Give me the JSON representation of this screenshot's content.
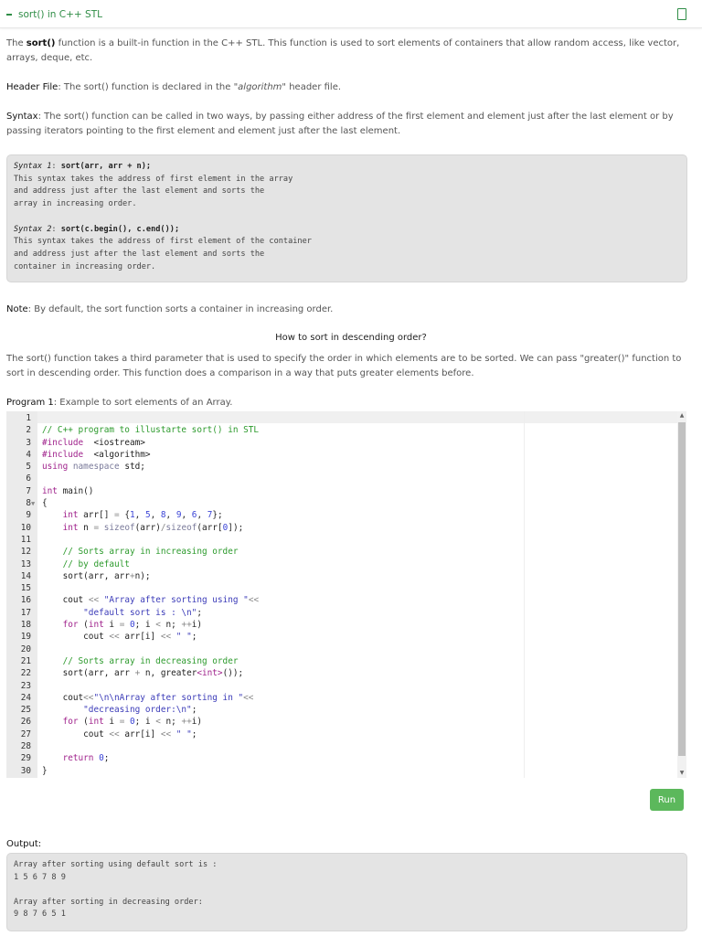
{
  "header": {
    "title": "sort() in C++ STL",
    "icon": "document-icon"
  },
  "intro": {
    "pre": "The ",
    "bold": "sort()",
    "post": " function is a built-in function in the C++ STL. This function is used to sort elements of containers that allow random access, like vector, arrays, deque, etc."
  },
  "header_file": {
    "label": "Header File",
    "pre": ": The sort() function is declared in the ",
    "italic": "\"algorithm\"",
    "post": " header file."
  },
  "syntax": {
    "label": "Syntax",
    "text": ": The sort() function can be called in two ways, by passing either address of the first element and element just after the last element or by passing iterators pointing to the first element and element just after the last element."
  },
  "syntax_box": {
    "s1_label": "Syntax 1",
    "s1_code": "sort(arr, arr + n);",
    "s1_desc": "This syntax takes the address of first element in the array\nand address just after the last element and sorts the\narray in increasing order.",
    "s2_label": "Syntax 2",
    "s2_code": "sort(c.begin(), c.end());",
    "s2_desc": "This syntax takes the address of first element of the container\nand address just after the last element and sorts the\ncontainer in increasing order."
  },
  "note": {
    "label": "Note",
    "text": ": By default, the sort function sorts a container in increasing order."
  },
  "subheading": "How to sort in descending order?",
  "desc": "The sort() function takes a third parameter that is used to specify the order in which elements are to be sorted. We can pass \"greater()\" function to sort in descending order. This function does a comparison in a way that puts greater elements before.",
  "program": {
    "label": "Program 1",
    "text": ": Example to sort elements of an Array."
  },
  "code": [
    [],
    [
      [
        "cm",
        "// C++ program to illustarte sort() in STL"
      ]
    ],
    [
      [
        "kw",
        "#include"
      ],
      [
        "",
        "  "
      ],
      [
        "",
        "<iostream>"
      ]
    ],
    [
      [
        "kw",
        "#include"
      ],
      [
        "",
        "  "
      ],
      [
        "",
        "<algorithm>"
      ]
    ],
    [
      [
        "kw",
        "using"
      ],
      [
        "",
        " "
      ],
      [
        "ns",
        "namespace"
      ],
      [
        "",
        " std;"
      ]
    ],
    [],
    [
      [
        "kw",
        "int"
      ],
      [
        "",
        " main()"
      ]
    ],
    [
      [
        "",
        "{"
      ]
    ],
    [
      [
        "",
        "    "
      ],
      [
        "kw",
        "int"
      ],
      [
        "",
        " arr[] "
      ],
      [
        "op",
        "="
      ],
      [
        "",
        " {"
      ],
      [
        "nm",
        "1"
      ],
      [
        "",
        ", "
      ],
      [
        "nm",
        "5"
      ],
      [
        "",
        ", "
      ],
      [
        "nm",
        "8"
      ],
      [
        "",
        ", "
      ],
      [
        "nm",
        "9"
      ],
      [
        "",
        ", "
      ],
      [
        "nm",
        "6"
      ],
      [
        "",
        ", "
      ],
      [
        "nm",
        "7"
      ],
      [
        "",
        "};"
      ]
    ],
    [
      [
        "",
        "    "
      ],
      [
        "kw",
        "int"
      ],
      [
        "",
        " n "
      ],
      [
        "op",
        "="
      ],
      [
        "",
        " "
      ],
      [
        "ns",
        "sizeof"
      ],
      [
        "",
        "(arr)"
      ],
      [
        "op",
        "/"
      ],
      [
        "ns",
        "sizeof"
      ],
      [
        "",
        "(arr["
      ],
      [
        "nm",
        "0"
      ],
      [
        "",
        "]);"
      ]
    ],
    [],
    [
      [
        "",
        "    "
      ],
      [
        "cm",
        "// Sorts array in increasing order"
      ]
    ],
    [
      [
        "",
        "    "
      ],
      [
        "cm",
        "// by default"
      ]
    ],
    [
      [
        "",
        "    sort(arr, arr"
      ],
      [
        "op",
        "+"
      ],
      [
        "",
        "n);"
      ]
    ],
    [],
    [
      [
        "",
        "    cout "
      ],
      [
        "op",
        "<<"
      ],
      [
        "",
        " "
      ],
      [
        "st",
        "\"Array after sorting using \""
      ],
      [
        "op",
        "<<"
      ]
    ],
    [
      [
        "",
        "        "
      ],
      [
        "st",
        "\"default sort is : \\n\""
      ],
      [
        "",
        ";"
      ]
    ],
    [
      [
        "",
        "    "
      ],
      [
        "kw",
        "for"
      ],
      [
        "",
        " ("
      ],
      [
        "kw",
        "int"
      ],
      [
        "",
        " i "
      ],
      [
        "op",
        "="
      ],
      [
        "",
        " "
      ],
      [
        "nm",
        "0"
      ],
      [
        "",
        "; i "
      ],
      [
        "op",
        "<"
      ],
      [
        "",
        " n; "
      ],
      [
        "op",
        "++"
      ],
      [
        "",
        "i)"
      ]
    ],
    [
      [
        "",
        "        cout "
      ],
      [
        "op",
        "<<"
      ],
      [
        "",
        " arr[i] "
      ],
      [
        "op",
        "<<"
      ],
      [
        "",
        " "
      ],
      [
        "st",
        "\" \""
      ],
      [
        "",
        ";"
      ]
    ],
    [],
    [
      [
        "",
        "    "
      ],
      [
        "cm",
        "// Sorts array in decreasing order"
      ]
    ],
    [
      [
        "",
        "    sort(arr, arr "
      ],
      [
        "op",
        "+"
      ],
      [
        "",
        " n, greater"
      ],
      [
        "kw",
        "<int>"
      ],
      [
        "",
        "());"
      ]
    ],
    [],
    [
      [
        "",
        "    cout"
      ],
      [
        "op",
        "<<"
      ],
      [
        "st",
        "\"\\n\\nArray after sorting in \""
      ],
      [
        "op",
        "<<"
      ]
    ],
    [
      [
        "",
        "        "
      ],
      [
        "st",
        "\"decreasing order:\\n\""
      ],
      [
        "",
        ";"
      ]
    ],
    [
      [
        "",
        "    "
      ],
      [
        "kw",
        "for"
      ],
      [
        "",
        " ("
      ],
      [
        "kw",
        "int"
      ],
      [
        "",
        " i "
      ],
      [
        "op",
        "="
      ],
      [
        "",
        " "
      ],
      [
        "nm",
        "0"
      ],
      [
        "",
        "; i "
      ],
      [
        "op",
        "<"
      ],
      [
        "",
        " n; "
      ],
      [
        "op",
        "++"
      ],
      [
        "",
        "i)"
      ]
    ],
    [
      [
        "",
        "        cout "
      ],
      [
        "op",
        "<<"
      ],
      [
        "",
        " arr[i] "
      ],
      [
        "op",
        "<<"
      ],
      [
        "",
        " "
      ],
      [
        "st",
        "\" \""
      ],
      [
        "",
        ";"
      ]
    ],
    [],
    [
      [
        "",
        "    "
      ],
      [
        "kw",
        "return"
      ],
      [
        "",
        " "
      ],
      [
        "nm",
        "0"
      ],
      [
        "",
        ";"
      ]
    ],
    [
      [
        "",
        "}"
      ]
    ]
  ],
  "run_label": "Run",
  "output": {
    "label": "Output:",
    "text": "Array after sorting using default sort is :\n1 5 6 7 8 9\n\nArray after sorting in decreasing order:\n9 8 7 6 5 1"
  }
}
